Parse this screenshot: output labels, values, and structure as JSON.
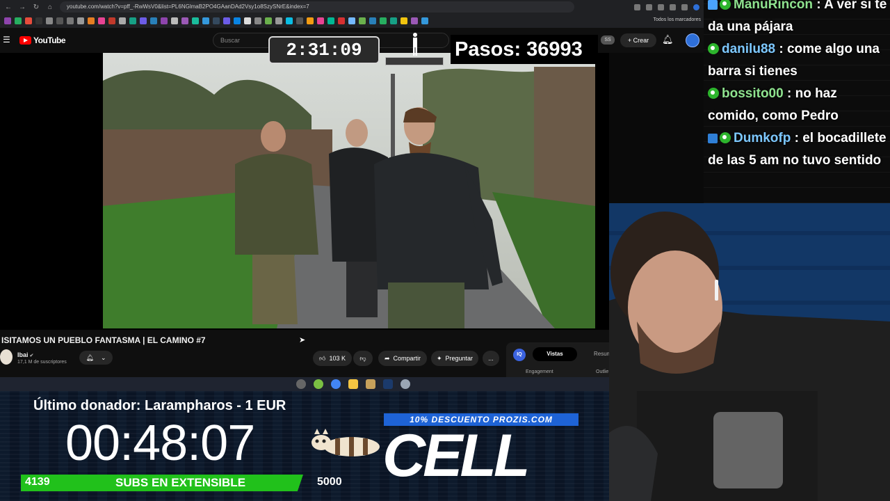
{
  "browser": {
    "url": "youtube.com/watch?v=pff_-RwWsV0&list=PL6NGlmaB2PO4GAanDAd2Vsy1o8SzySNrE&index=7",
    "bookmarks_all_label": "Todos los marcadores"
  },
  "youtube": {
    "logo_text": "YouTube",
    "search_placeholder": "Buscar",
    "ss_badge": "SS",
    "create_label": "Crear"
  },
  "overlay": {
    "timer": "2:31:09",
    "steps_label": "Pasos: 36993"
  },
  "video": {
    "title": "ISITAMOS UN PUEBLO FANTASMA | EL CAMINO #7",
    "channel_name": "Ibai",
    "subscribers": "17,1 M de suscriptores",
    "likes": "103 K",
    "share_label": "Compartir",
    "ask_label": "Preguntar",
    "more_label": "...",
    "panel": {
      "badge": "IQ",
      "tab_active": "Vistas",
      "tab_other": "Resum",
      "label_engagement": "Engagement",
      "label_outliers": "Outlie"
    }
  },
  "stream": {
    "last_donor": "Último donador: Larampharos - 1 EUR",
    "countdown": "00:48:07",
    "subs_current": "4139",
    "subs_label": "SUBS EN EXTENSIBLE",
    "subs_goal": "5000",
    "subs_progress": 0.83,
    "promo": "10% DESCUENTO PROZIS.COM",
    "sponsor": "CELL"
  },
  "chat": [
    {
      "user": "ManuRincon",
      "text": ": A ver si te da una pájara",
      "color": "#8fe38f"
    },
    {
      "user": "danilu88",
      "text": ": come algo una barra si tienes",
      "color": "#7dc8ff"
    },
    {
      "user": "bossito00",
      "text": ": no haz comido, como Pedro",
      "color": "#8fe38f"
    },
    {
      "user": "Dumkofp",
      "text": ": el bocadillete de las 5 am no tuvo sentido",
      "color": "#7dc8ff"
    }
  ]
}
